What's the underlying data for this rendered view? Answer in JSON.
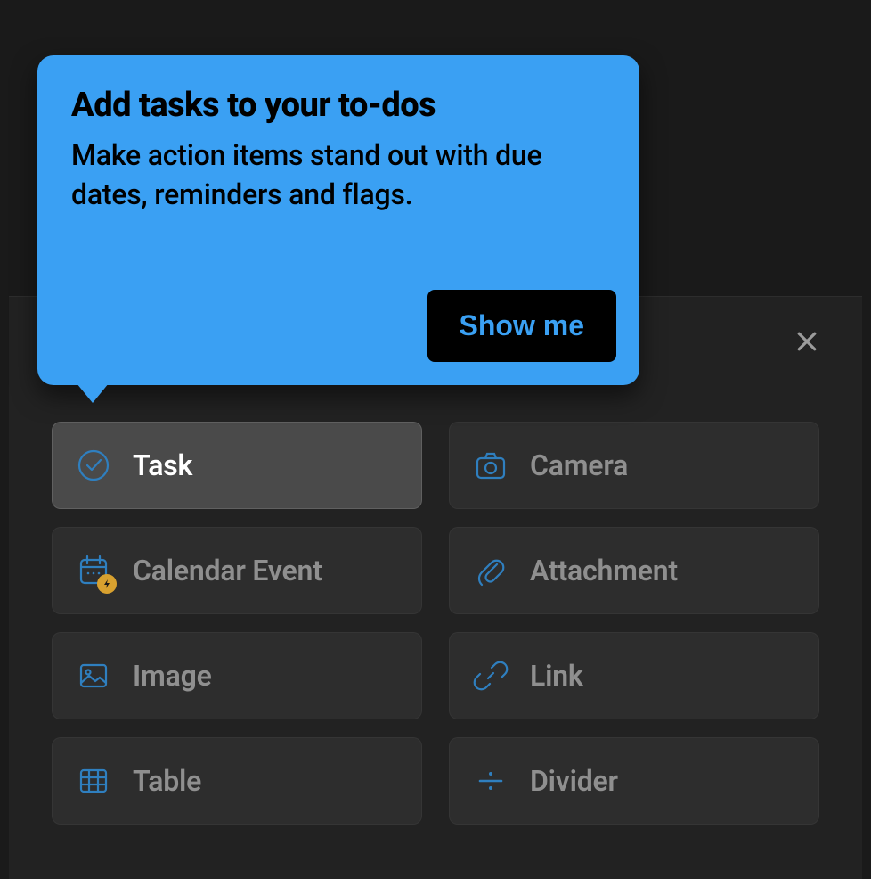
{
  "coach": {
    "title": "Add tasks to your to-dos",
    "body": "Make action items stand out with due dates, reminders and flags.",
    "cta": "Show me"
  },
  "tiles": {
    "task": {
      "label": "Task",
      "icon": "task-icon",
      "active": true
    },
    "camera": {
      "label": "Camera",
      "icon": "camera-icon",
      "active": false
    },
    "calendar": {
      "label": "Calendar Event",
      "icon": "calendar-icon",
      "active": false,
      "badge": true
    },
    "attachment": {
      "label": "Attachment",
      "icon": "paperclip-icon",
      "active": false
    },
    "image": {
      "label": "Image",
      "icon": "image-icon",
      "active": false
    },
    "link": {
      "label": "Link",
      "icon": "link-icon",
      "active": false
    },
    "table": {
      "label": "Table",
      "icon": "table-icon",
      "active": false
    },
    "divider": {
      "label": "Divider",
      "icon": "divider-icon",
      "active": false
    }
  },
  "colors": {
    "accent": "#3aa0f3",
    "icon_stroke": "#2f7fbf",
    "badge": "#d8a12f"
  }
}
